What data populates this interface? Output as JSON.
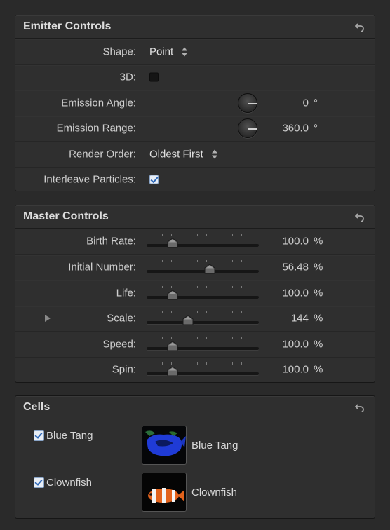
{
  "emitter": {
    "title": "Emitter Controls",
    "shape_label": "Shape:",
    "shape_value": "Point",
    "threed_label": "3D:",
    "threed_checked": false,
    "angle_label": "Emission Angle:",
    "angle_value": "0",
    "angle_unit": "°",
    "range_label": "Emission Range:",
    "range_value": "360.0",
    "range_unit": "°",
    "order_label": "Render Order:",
    "order_value": "Oldest First",
    "interleave_label": "Interleave Particles:",
    "interleave_checked": true
  },
  "master": {
    "title": "Master Controls",
    "rows": [
      {
        "label": "Birth Rate:",
        "value": "100.0",
        "unit": "%",
        "position": 0.23
      },
      {
        "label": "Initial Number:",
        "value": "56.48",
        "unit": "%",
        "position": 0.56
      },
      {
        "label": "Life:",
        "value": "100.0",
        "unit": "%",
        "position": 0.23
      },
      {
        "label": "Scale:",
        "value": "144",
        "unit": "%",
        "position": 0.37
      },
      {
        "label": "Speed:",
        "value": "100.0",
        "unit": "%",
        "position": 0.23
      },
      {
        "label": "Spin:",
        "value": "100.0",
        "unit": "%",
        "position": 0.23
      }
    ]
  },
  "cells": {
    "title": "Cells",
    "items": [
      {
        "check_label": "Blue Tang",
        "name": "Blue Tang",
        "checked": true
      },
      {
        "check_label": "Clownfish",
        "name": "Clownfish",
        "checked": true
      }
    ]
  }
}
